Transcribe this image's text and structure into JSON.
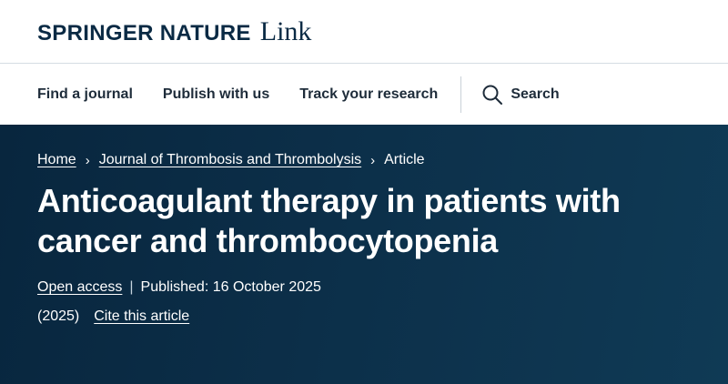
{
  "header": {
    "brand": "SPRINGER NATURE",
    "product": "Link"
  },
  "nav": {
    "items": [
      "Find a journal",
      "Publish with us",
      "Track your research"
    ],
    "search_label": "Search"
  },
  "breadcrumb": {
    "home": "Home",
    "journal": "Journal of Thrombosis and Thrombolysis",
    "current": "Article",
    "separator": "›"
  },
  "article": {
    "title": "Anticoagulant therapy in patients with cancer and thrombocytopenia",
    "access": "Open access",
    "separator": "|",
    "published": "Published: 16 October 2025",
    "year": "(2025)",
    "cite_label": "Cite this article"
  },
  "colors": {
    "brand": "#0a2a44",
    "hero_bg": "#0c2f49"
  }
}
